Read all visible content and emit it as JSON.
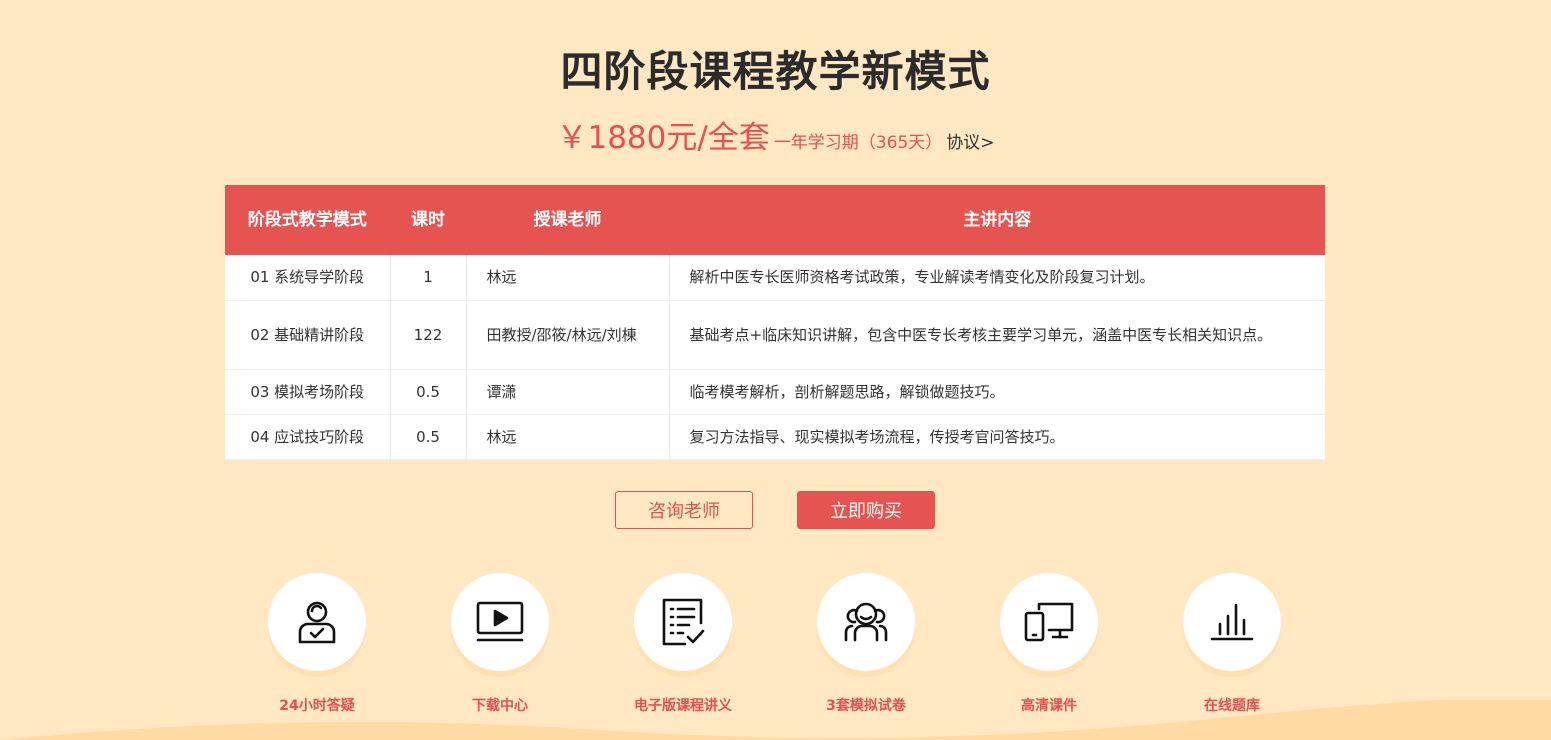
{
  "header": {
    "title": "四阶段课程教学新模式",
    "price": "￥1880元/全套",
    "period": "一年学习期（365天）",
    "agreement": "协议>"
  },
  "table": {
    "headers": [
      "阶段式教学模式",
      "课时",
      "授课老师",
      "主讲内容"
    ],
    "rows": [
      {
        "stage": "01 系统导学阶段",
        "hours": "1",
        "teacher": "林远",
        "content": "解析中医专长医师资格考试政策，专业解读考情变化及阶段复习计划。"
      },
      {
        "stage": "02 基础精讲阶段",
        "hours": "122",
        "teacher": "田教授/邵筱/林远/刘棟",
        "content": "基础考点+临床知识讲解，包含中医专长考核主要学习单元，涵盖中医专长相关知识点。"
      },
      {
        "stage": "03 模拟考场阶段",
        "hours": "0.5",
        "teacher": "谭潇",
        "content": "临考模考解析，剖析解题思路，解锁做题技巧。"
      },
      {
        "stage": "04 应试技巧阶段",
        "hours": "0.5",
        "teacher": "林远",
        "content": "复习方法指导、现实模拟考场流程，传授考官问答技巧。"
      }
    ]
  },
  "buttons": {
    "consult": "咨询老师",
    "buy": "立即购买"
  },
  "features": [
    {
      "label": "24小时答疑",
      "icon": "person-check-icon"
    },
    {
      "label": "下载中心",
      "icon": "video-play-icon"
    },
    {
      "label": "电子版课程讲义",
      "icon": "document-check-icon"
    },
    {
      "label": "3套模拟试卷",
      "icon": "group-people-icon"
    },
    {
      "label": "高清课件",
      "icon": "devices-icon"
    },
    {
      "label": "在线题库",
      "icon": "bar-chart-icon"
    }
  ],
  "colors": {
    "accent": "#e55451",
    "background": "#ffe8c2"
  }
}
